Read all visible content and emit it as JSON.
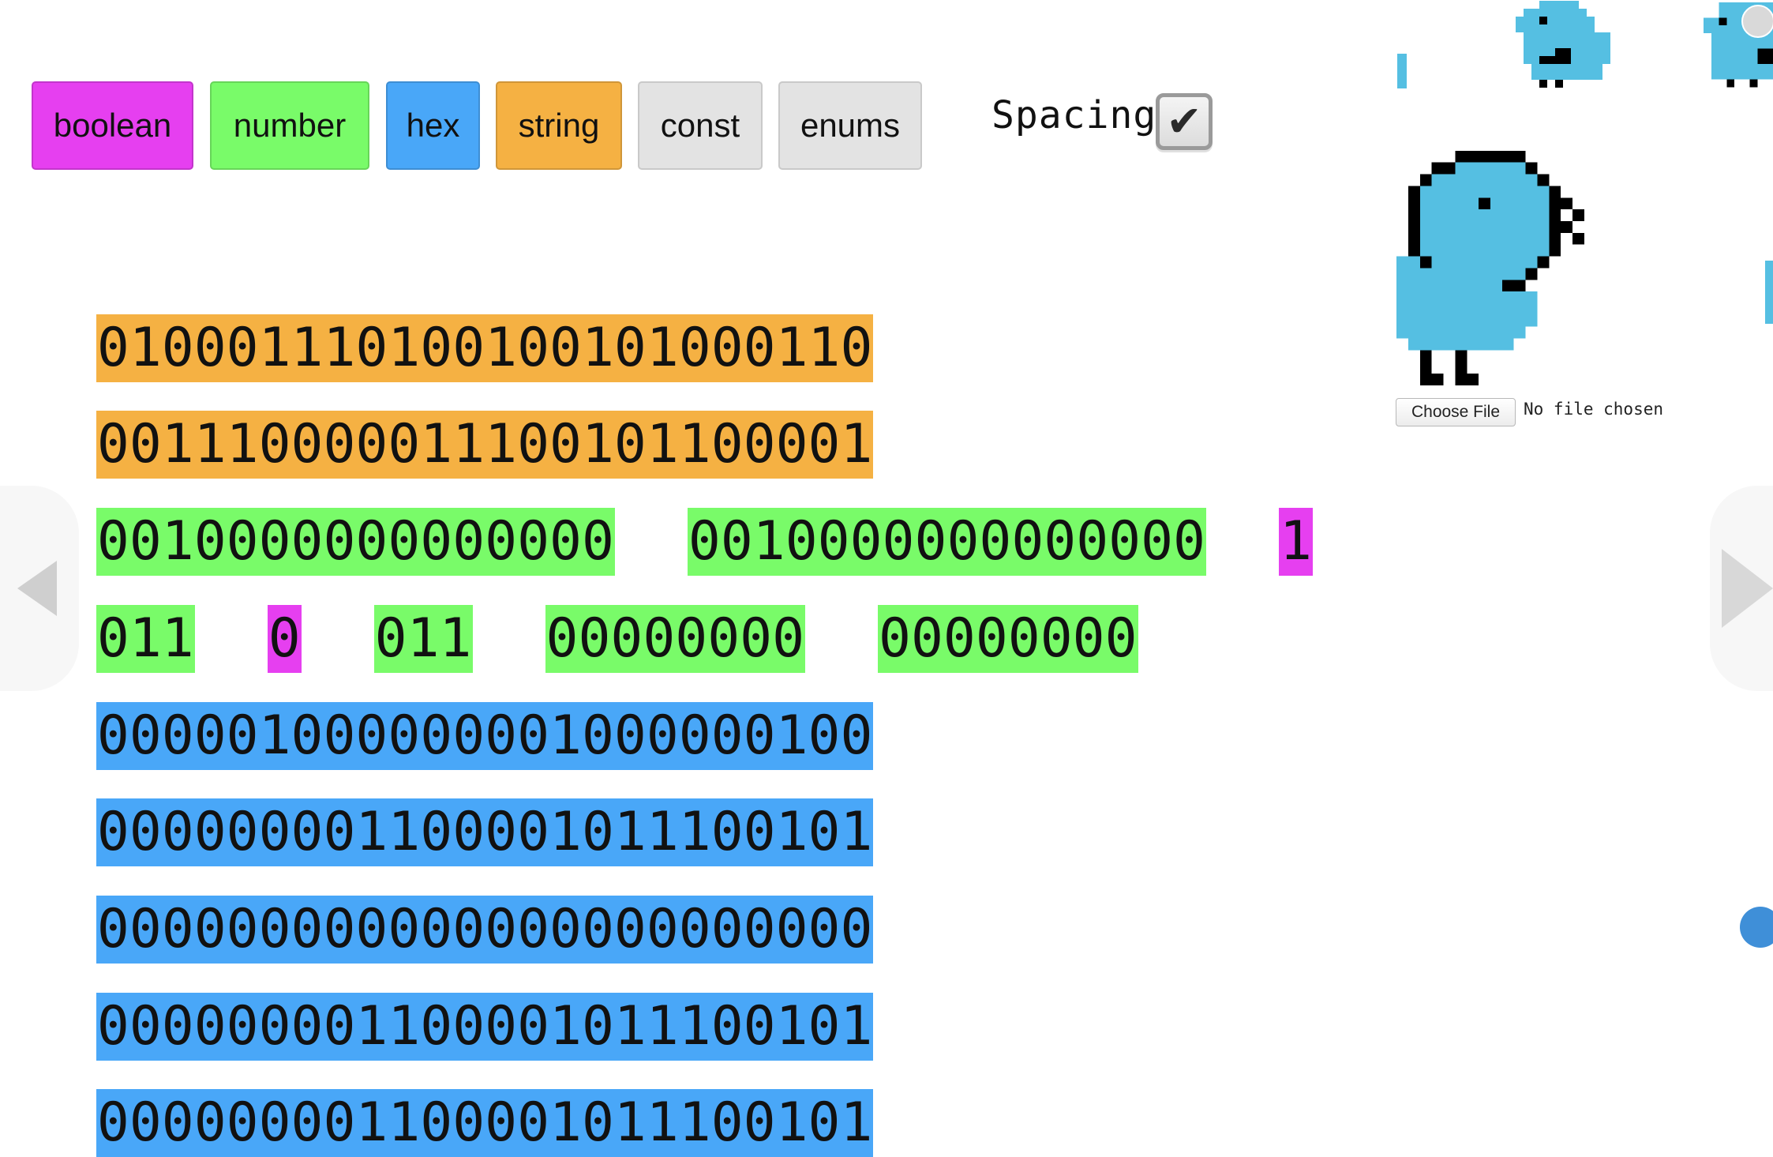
{
  "toolbar": {
    "buttons": [
      {
        "id": "boolean",
        "label": "boolean",
        "color": "#e63ff0"
      },
      {
        "id": "number",
        "label": "number",
        "color": "#79fb69"
      },
      {
        "id": "hex",
        "label": "hex",
        "color": "#49a7f8"
      },
      {
        "id": "string",
        "label": "string",
        "color": "#f5b143"
      },
      {
        "id": "const",
        "label": "const",
        "color": "#e3e3e3"
      },
      {
        "id": "enums",
        "label": "enums",
        "color": "#e3e3e3"
      }
    ],
    "spacing_label": "Spacing",
    "spacing_checked": true
  },
  "bit_rows": [
    {
      "type": "string",
      "bits": "010001110100100101000110"
    },
    {
      "type": "string",
      "bits": "001110000011100101100001"
    },
    {
      "type": "number",
      "bits": "0010000000000000"
    },
    {
      "type": "number",
      "bits": "0010000000000000"
    },
    {
      "type": "boolean",
      "bits": "1"
    },
    {
      "type": "number",
      "bits": "011"
    },
    {
      "type": "boolean",
      "bits": "0"
    },
    {
      "type": "number",
      "bits": "011"
    },
    {
      "type": "number",
      "bits": "00000000"
    },
    {
      "type": "number",
      "bits": "00000000"
    },
    {
      "type": "hex",
      "bits": "000001000000001000000100"
    },
    {
      "type": "hex",
      "bits": "000000001100001011100101"
    },
    {
      "type": "hex",
      "bits": "000000000000000000000000"
    },
    {
      "type": "hex",
      "bits": "000000001100001011100101"
    },
    {
      "type": "hex",
      "bits": "000000001100001011100101"
    }
  ],
  "file_input": {
    "button_label": "Choose File",
    "status": "No file chosen"
  },
  "icons": {
    "checkmark": "check-icon",
    "nav_prev": "chevron-left-icon",
    "nav_next": "chevron-right-icon",
    "sprite": "pixel-bird-sprite",
    "chat": "chat-bubble-icon"
  },
  "colors": {
    "boolean": "#e63ff0",
    "number": "#79fb69",
    "hex": "#49a7f8",
    "string": "#f5b143",
    "sprite_body": "#55bfe2",
    "sprite_outline": "#000000"
  }
}
